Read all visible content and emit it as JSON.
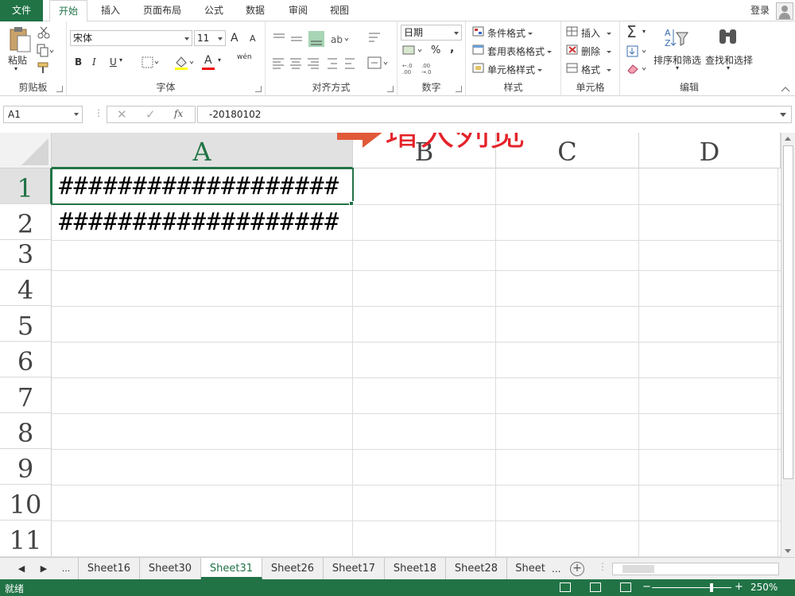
{
  "tabs": {
    "file": "文件",
    "items": [
      "开始",
      "插入",
      "页面布局",
      "公式",
      "数据",
      "审阅",
      "视图"
    ],
    "active": "开始",
    "login": "登录"
  },
  "ribbon": {
    "clipboard": {
      "label": "剪贴板",
      "paste": "粘贴"
    },
    "font": {
      "label": "字体",
      "font_name": "宋体",
      "font_size": "11",
      "bold": "B",
      "italic": "I",
      "underline": "U",
      "grow": "A",
      "shrink": "A",
      "font_color_glyph": "A",
      "phonetic": "wén"
    },
    "alignment": {
      "label": "对齐方式"
    },
    "number": {
      "label": "数字",
      "format": "日期",
      "percent": "%",
      "comma": ","
    },
    "styles": {
      "label": "样式",
      "conditional": "条件格式",
      "table": "套用表格格式",
      "cell_styles": "单元格样式"
    },
    "cells": {
      "label": "单元格",
      "insert": "插入",
      "delete": "删除",
      "format": "格式"
    },
    "editing": {
      "label": "编辑",
      "sum": "Σ",
      "sort_filter": "排序和筛选",
      "find_select": "查找和选择"
    }
  },
  "formula_bar": {
    "name_box": "A1",
    "fx": "fx",
    "value": "-20180102"
  },
  "grid": {
    "columns": [
      "A",
      "B",
      "C",
      "D"
    ],
    "rows": [
      "1",
      "2",
      "3",
      "4",
      "5",
      "6",
      "7",
      "8",
      "9",
      "10",
      "11"
    ],
    "cells": {
      "A1": "###################",
      "A2": "###################"
    },
    "selected": "A1"
  },
  "annotation": "增大列宽",
  "sheets": {
    "ellipsis": "...",
    "tabs": [
      "Sheet16",
      "Sheet30",
      "Sheet31",
      "Sheet26",
      "Sheet17",
      "Sheet18",
      "Sheet28",
      "Sheet"
    ],
    "active": "Sheet31",
    "more": "...",
    "add": "+"
  },
  "status": {
    "text": "就绪",
    "zoom": "250%",
    "minus": "−",
    "plus": "+"
  },
  "colors": {
    "excel_green": "#217346",
    "annotation_red": "#e4232a",
    "arrow_orange": "#e05a3a"
  }
}
